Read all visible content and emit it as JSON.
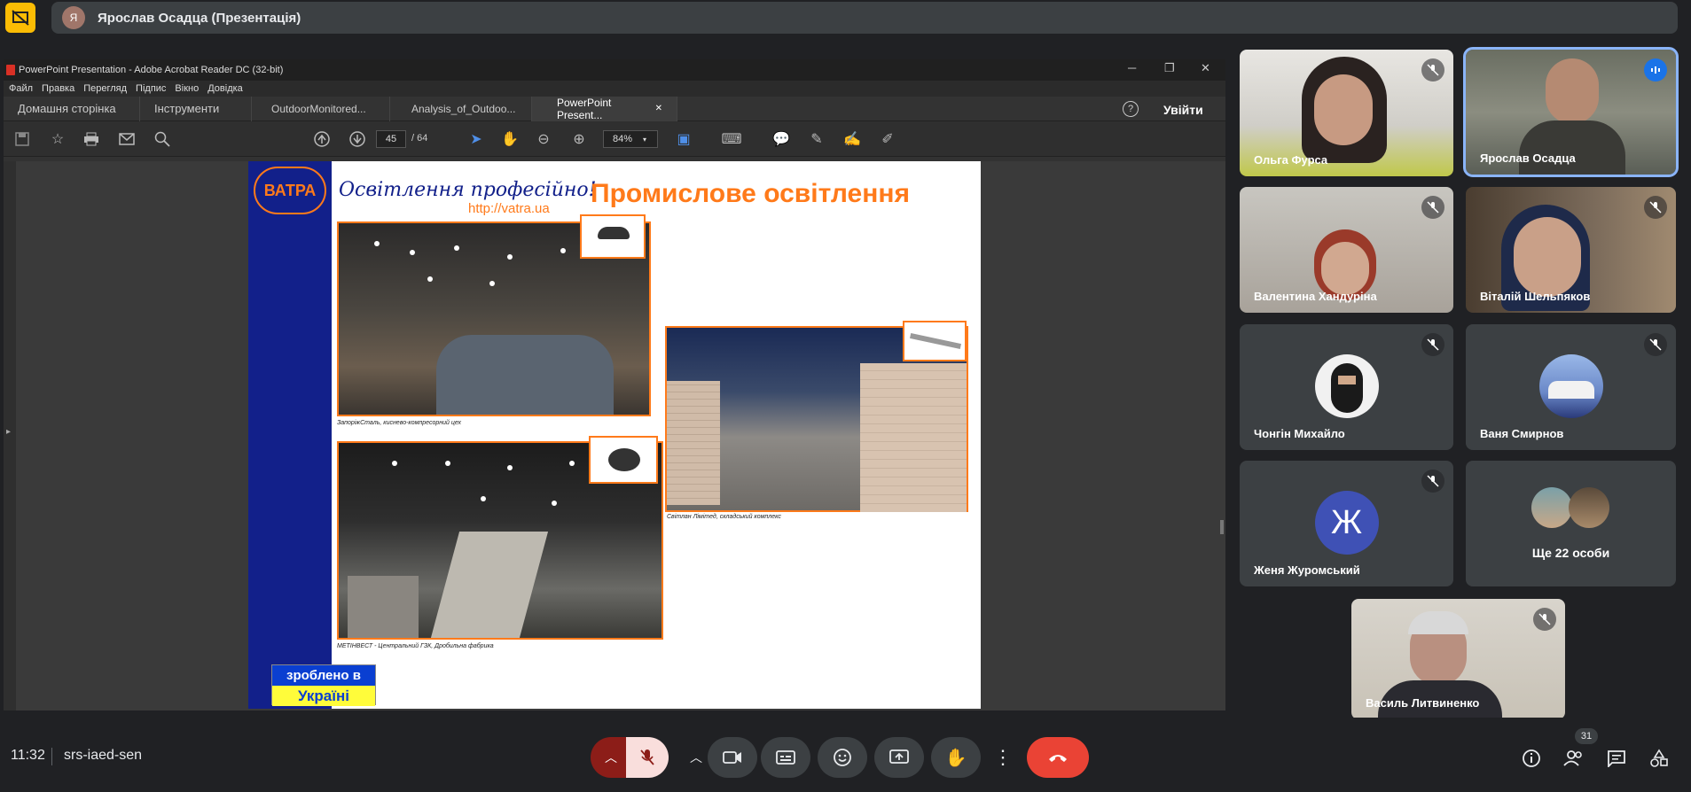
{
  "meet": {
    "presenter_initial": "Я",
    "presenter_label": "Ярослав Осадца (Презентація)",
    "time": "11:32",
    "meeting_code": "srs-iaed-sen",
    "people_count": "31"
  },
  "acrobat": {
    "window_title": "PowerPoint Presentation - Adobe Acrobat Reader DC (32-bit)",
    "menu": [
      "Файл",
      "Правка",
      "Перегляд",
      "Підпис",
      "Вікно",
      "Довідка"
    ],
    "tabs": {
      "home": "Домашня сторінка",
      "tools": "Інструменти",
      "doc1": "OutdoorMonitored...",
      "doc2": "Analysis_of_Outdoo...",
      "doc3": "PowerPoint Present..."
    },
    "signin": "Увійти",
    "page_current": "45",
    "page_total": "/ 64",
    "zoom": "84%"
  },
  "slide": {
    "logo": "ВАТРА",
    "tagline": "Освітлення професійно!",
    "url": "http://vatra.ua",
    "title": "Промислове освітлення",
    "caption1": "ЗапоріжСталь, киснево-компресорний цех",
    "caption2": "Світлан Лімітед, складський комплекс",
    "caption3": "МЕТІНВЕСТ - Центральний ГЗК, Дробильна фабрика",
    "made_in_line1": "зроблено в",
    "made_in_line2": "Україні"
  },
  "participants": [
    {
      "name": "Ольга Фурса",
      "muted": true
    },
    {
      "name": "Ярослав Осадца",
      "muted": false,
      "speaking": true
    },
    {
      "name": "Валентина Хандуріна",
      "muted": true
    },
    {
      "name": "Віталій Шельпяков",
      "muted": true
    },
    {
      "name": "Чонгін Михайло",
      "muted": true
    },
    {
      "name": "Ваня Смирнов",
      "muted": true
    },
    {
      "name": "Женя Журомський",
      "initial": "Ж",
      "muted": true
    },
    {
      "name": "Ще 22 особи"
    },
    {
      "name": "Василь Литвиненко",
      "muted": true
    }
  ],
  "colors": {
    "accent_orange": "#ff7a1a",
    "slide_navy": "#12208a",
    "end_call_red": "#ea4335",
    "speaking_outline": "#8ab4f8",
    "avatar_zh": "#3f51b5"
  }
}
